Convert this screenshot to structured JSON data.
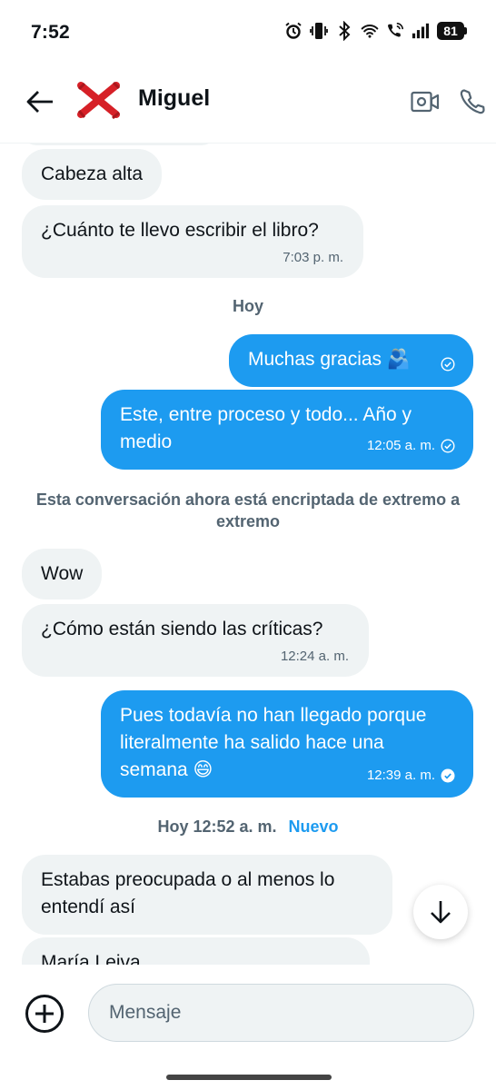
{
  "status_bar": {
    "time": "7:52",
    "battery": "81",
    "icons": [
      "alarm-icon",
      "vibrate-icon",
      "bluetooth-icon",
      "wifi-icon",
      "wifi-call-icon",
      "signal-icon",
      "battery-icon"
    ]
  },
  "header": {
    "name": "Miguel",
    "back_icon": "arrow-left-icon",
    "avatar_icon": "red-x-avatar",
    "video_icon": "video-camera-icon",
    "call_icon": "phone-icon"
  },
  "messages": [
    {
      "text": "Cabeza alta",
      "direction": "incoming"
    },
    {
      "text": "¿Cuánto te llevo escribir el libro?",
      "time": "7:03 p. m.",
      "direction": "incoming"
    },
    {
      "separator": "Hoy"
    },
    {
      "text": "Muchas gracias 🫂",
      "status": "sent",
      "direction": "outgoing"
    },
    {
      "text": "Este, entre proceso y todo... Año y medio",
      "time": "12:05 a. m.",
      "status": "sent",
      "direction": "outgoing"
    },
    {
      "notice": "Esta conversación ahora está encriptada de extremo a extremo"
    },
    {
      "text": "Wow",
      "direction": "incoming"
    },
    {
      "text": "¿Cómo están siendo las críticas?",
      "time": "12:24 a. m.",
      "direction": "incoming"
    },
    {
      "text": "Pues todavía no han llegado porque literalmente ha salido hace una semana 😄",
      "time": "12:39 a. m.",
      "status": "read",
      "direction": "outgoing"
    },
    {
      "separator": "Hoy 12:52 a. m.",
      "badge": "Nuevo"
    },
    {
      "text": "Estabas preocupada o al menos lo entendí así",
      "direction": "incoming"
    },
    {
      "text": "María Leiva",
      "direction": "incoming"
    }
  ],
  "composer": {
    "placeholder": "Mensaje",
    "add_icon": "plus-circle-icon"
  },
  "scroll_down_icon": "arrow-down-icon",
  "colors": {
    "accent": "#1d9bf0",
    "incoming_bubble": "#eff3f4",
    "secondary_text": "#536471",
    "avatar_red": "#d62027"
  }
}
